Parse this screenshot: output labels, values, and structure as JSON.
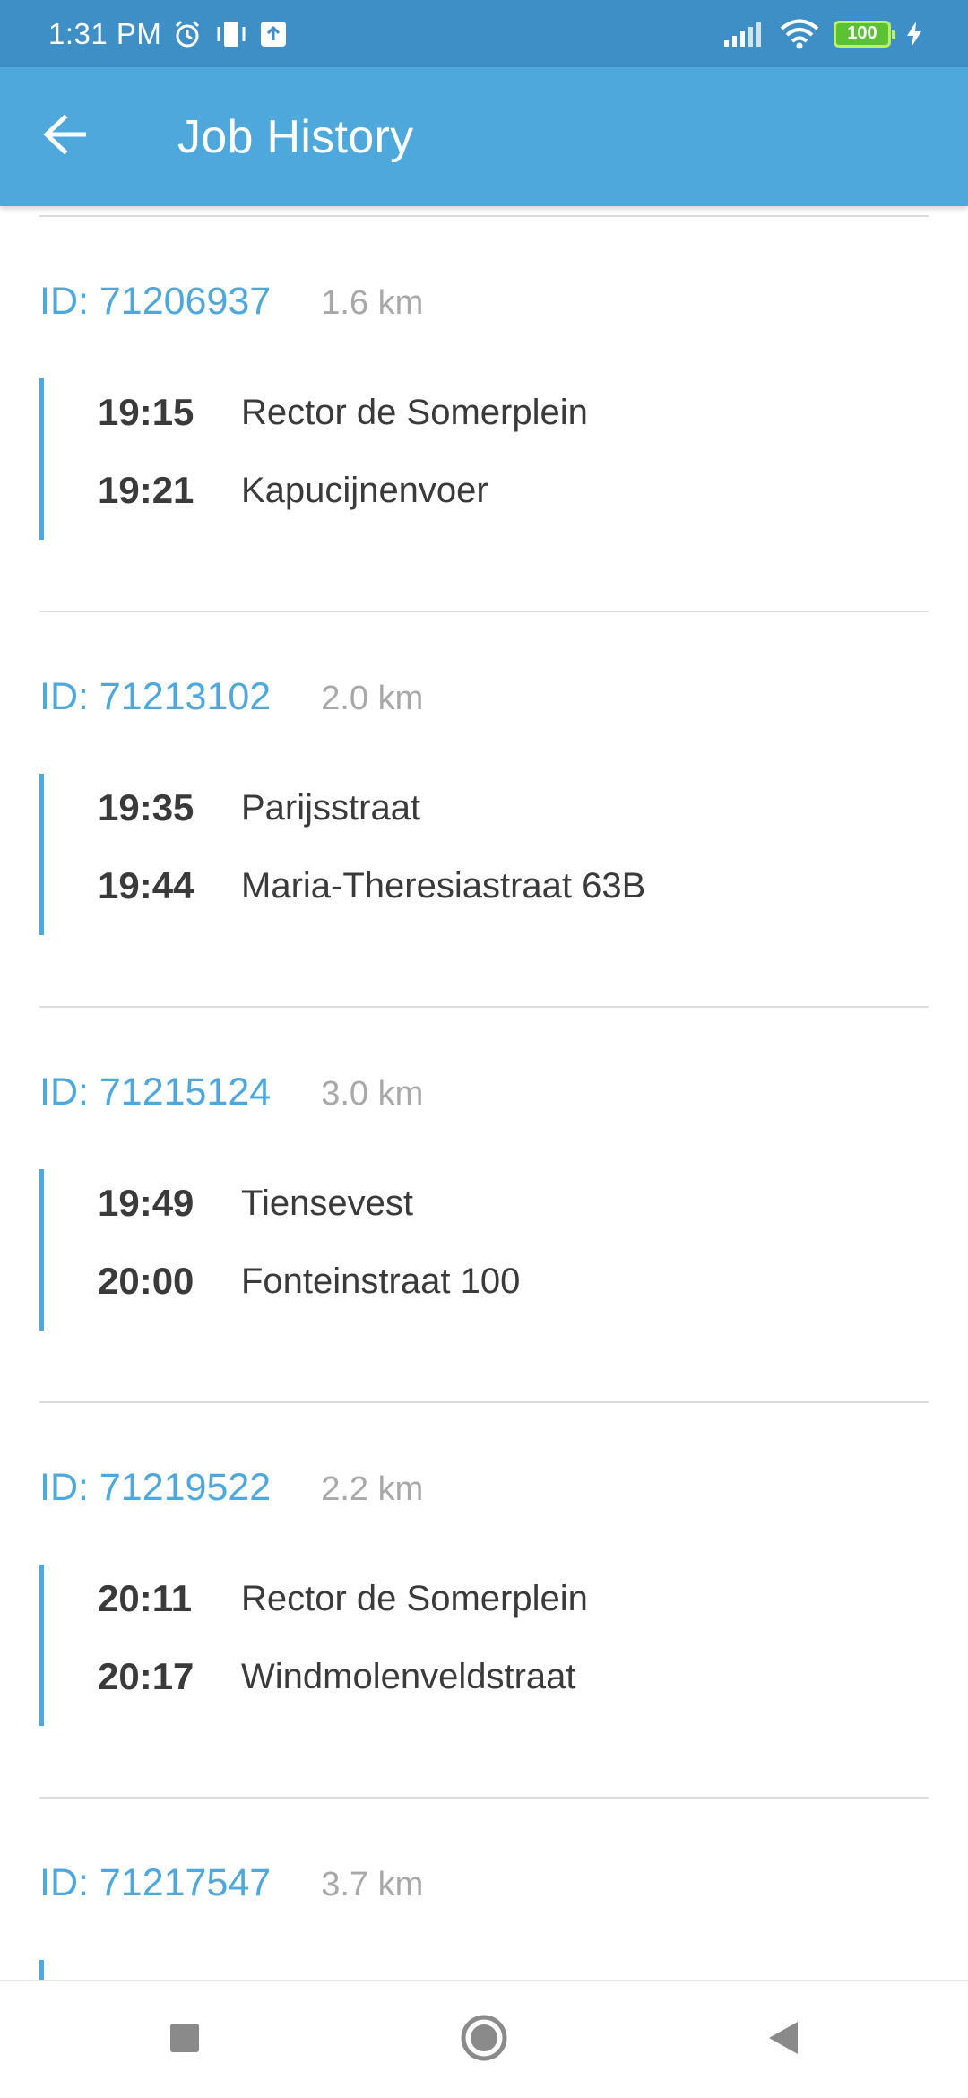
{
  "status_bar": {
    "time": "1:31 PM",
    "battery_level": "100",
    "icons": [
      "alarm-icon",
      "vibrate-icon",
      "upload-icon",
      "signal-icon",
      "wifi-icon",
      "battery-icon",
      "charging-icon"
    ]
  },
  "app_bar": {
    "title": "Job History",
    "back_icon": "arrow-left-icon"
  },
  "colors": {
    "status_bar": "#3f8fc7",
    "app_bar": "#4fa8dc",
    "accent": "#4fa8dc",
    "distance": "#a8a8a8",
    "text": "#3a3a3a"
  },
  "jobs": [
    {
      "id": "ID: 71206937",
      "distance": "1.6 km",
      "stops": [
        {
          "time": "19:15",
          "address": "Rector de Somerplein"
        },
        {
          "time": "19:21",
          "address": "Kapucijnenvoer"
        }
      ]
    },
    {
      "id": "ID: 71213102",
      "distance": "2.0 km",
      "stops": [
        {
          "time": "19:35",
          "address": "Parijsstraat"
        },
        {
          "time": "19:44",
          "address": "Maria-Theresiastraat 63B"
        }
      ]
    },
    {
      "id": "ID: 71215124",
      "distance": "3.0 km",
      "stops": [
        {
          "time": "19:49",
          "address": "Tiensevest"
        },
        {
          "time": "20:00",
          "address": "Fonteinstraat 100"
        }
      ]
    },
    {
      "id": "ID: 71219522",
      "distance": "2.2 km",
      "stops": [
        {
          "time": "20:11",
          "address": "Rector de Somerplein"
        },
        {
          "time": "20:17",
          "address": "Windmolenveldstraat"
        }
      ]
    },
    {
      "id": "ID: 71217547",
      "distance": "3.7 km",
      "stops": []
    }
  ],
  "nav_bar": {
    "items": [
      "recents-square-icon",
      "home-circle-icon",
      "back-triangle-icon"
    ]
  }
}
